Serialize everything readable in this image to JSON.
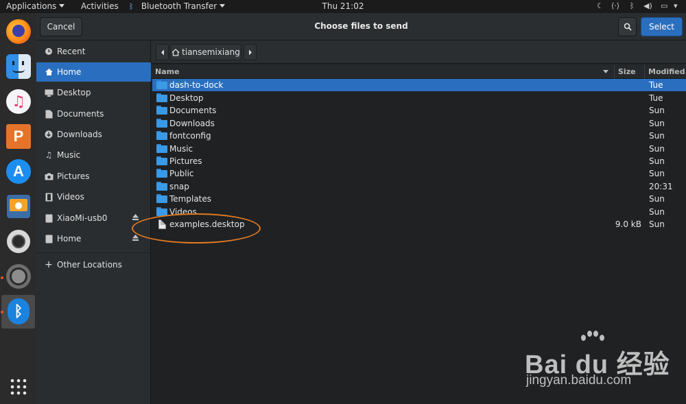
{
  "topbar": {
    "applications": "Applications",
    "activities": "Activities",
    "app_name": "Bluetooth Transfer",
    "clock": "Thu 21:02"
  },
  "dock": {
    "apps": [
      "firefox-icon",
      "finder-icon",
      "music-icon",
      "presentation-icon",
      "app-store-icon",
      "file-transfer-icon",
      "lifebuoy-icon",
      "system-settings-icon",
      "bluetooth-icon",
      "show-apps-icon"
    ]
  },
  "header": {
    "cancel_label": "Cancel",
    "title": "Choose files to send",
    "select_label": "Select"
  },
  "sidebar": {
    "items": [
      {
        "label": "Recent",
        "icon": "clock-icon"
      },
      {
        "label": "Home",
        "icon": "home-icon"
      },
      {
        "label": "Desktop",
        "icon": "desktop-icon"
      },
      {
        "label": "Documents",
        "icon": "document-icon"
      },
      {
        "label": "Downloads",
        "icon": "download-icon"
      },
      {
        "label": "Music",
        "icon": "music-note-icon"
      },
      {
        "label": "Pictures",
        "icon": "camera-icon"
      },
      {
        "label": "Videos",
        "icon": "film-icon"
      },
      {
        "label": "XiaoMi-usb0",
        "icon": "drive-icon"
      },
      {
        "label": "Home",
        "icon": "drive-icon"
      },
      {
        "label": "Other Locations",
        "icon": "plus-icon"
      }
    ]
  },
  "pathbar": {
    "current": "tiansemixiang"
  },
  "columns": {
    "name": "Name",
    "size": "Size",
    "modified": "Modified"
  },
  "files": [
    {
      "name": "dash-to-dock",
      "size": "",
      "modified": "Tue",
      "type": "folder"
    },
    {
      "name": "Desktop",
      "size": "",
      "modified": "Tue",
      "type": "folder"
    },
    {
      "name": "Documents",
      "size": "",
      "modified": "Sun",
      "type": "folder"
    },
    {
      "name": "Downloads",
      "size": "",
      "modified": "Sun",
      "type": "folder"
    },
    {
      "name": "fontconfig",
      "size": "",
      "modified": "Sun",
      "type": "folder"
    },
    {
      "name": "Music",
      "size": "",
      "modified": "Sun",
      "type": "folder"
    },
    {
      "name": "Pictures",
      "size": "",
      "modified": "Sun",
      "type": "folder"
    },
    {
      "name": "Public",
      "size": "",
      "modified": "Sun",
      "type": "folder"
    },
    {
      "name": "snap",
      "size": "",
      "modified": "20:31",
      "type": "folder"
    },
    {
      "name": "Templates",
      "size": "",
      "modified": "Sun",
      "type": "folder"
    },
    {
      "name": "Videos",
      "size": "",
      "modified": "Sun",
      "type": "folder"
    },
    {
      "name": "examples.desktop",
      "size": "9.0 kB",
      "modified": "Sun",
      "type": "file"
    }
  ],
  "watermark": {
    "main": "Bai du 经验",
    "sub": "jingyan.baidu.com"
  },
  "colors": {
    "accent": "#2a6fbf",
    "annotation": "#e07a22"
  }
}
